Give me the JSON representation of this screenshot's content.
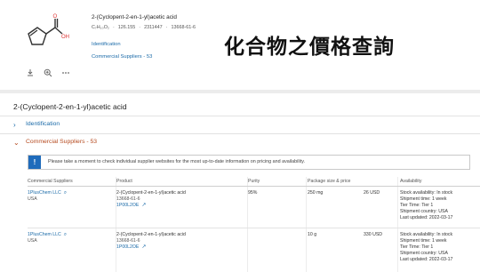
{
  "summary": {
    "title": "2-(Cyclopent-2-en-1-yl)acetic acid",
    "formula": "C₇H₁₀O₂",
    "mw": "126.155",
    "cid": "2311447",
    "cas": "13668-61-6",
    "identification_link": "Identification",
    "suppliers_link": "Commercial Suppliers - 53"
  },
  "caption": "化合物之價格查詢",
  "page": {
    "title": "2-(Cyclopent-2-en-1-yl)acetic acid",
    "sections": [
      {
        "label": "Identification",
        "expanded": false
      },
      {
        "label": "Commercial Suppliers - 53",
        "expanded": true
      }
    ],
    "alert_icon": "!",
    "alert_text": "Please take a moment to check individual supplier websites for the most up-to-date information on pricing and availability."
  },
  "table": {
    "headers": [
      "Commercial Suppliers",
      "Product",
      "Purity",
      "Package size & price",
      "",
      "Availability"
    ],
    "rows": [
      {
        "supplier": "1PlusChem LLC",
        "country": "USA",
        "product_name": "2-(Cyclopent-2-en-1-yl)acetic acid",
        "product_cas": "13668-61-6",
        "product_id": "1P00L2OE",
        "purity": "95%",
        "package": "250 mg",
        "price": "26 USD",
        "availability": [
          "Stock availability: In stock",
          "Shipment time: 1 week",
          "Tier Time: Tier 1",
          "Shipment country: USA",
          "Last updated: 2022-03-17"
        ]
      },
      {
        "supplier": "1PlusChem LLC",
        "country": "USA",
        "product_name": "2-(Cyclopent-2-en-1-yl)acetic acid",
        "product_cas": "13668-61-6",
        "product_id": "1P00L2OE",
        "purity": "",
        "package": "10 g",
        "price": "330 USD",
        "availability": [
          "Stock availability: In stock",
          "Shipment time: 1 week",
          "Tier Time: Tier 1",
          "Shipment country: USA",
          "Last updated: 2022-03-17"
        ]
      }
    ]
  },
  "icons": {
    "thumb_actions": [
      "download-icon",
      "zoom-icon",
      "more-icon"
    ],
    "section_expand": "chevron-right-icon",
    "section_collapse": "chevron-down-icon",
    "supplier_search": "search-icon"
  }
}
